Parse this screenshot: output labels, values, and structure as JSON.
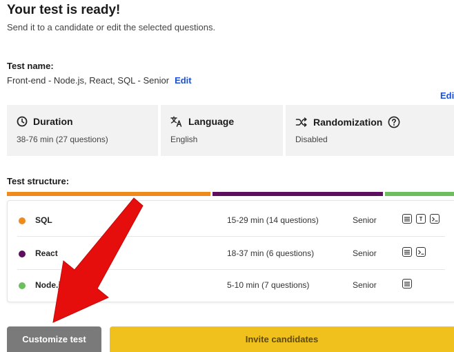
{
  "header": {
    "title": "Your test is ready!",
    "subtitle": "Send it to a candidate or edit the selected questions."
  },
  "test_name": {
    "label": "Test name:",
    "value": "Front-end - Node.js, React, SQL - Senior",
    "edit_label": "Edit",
    "edit_right_label": "Edi"
  },
  "info": {
    "duration": {
      "label": "Duration",
      "value": "38-76 min (27 questions)",
      "icon": "clock-icon"
    },
    "language": {
      "label": "Language",
      "value": "English",
      "icon": "translate-icon"
    },
    "randomization": {
      "label": "Randomization",
      "value": "Disabled",
      "icon": "shuffle-icon",
      "help_icon": "help-icon"
    }
  },
  "structure": {
    "label": "Test structure:",
    "segments": [
      {
        "name": "SQL",
        "fraction": 0.451,
        "color": "#ef8a1c"
      },
      {
        "name": "React",
        "fraction": 0.378,
        "color": "#5c0f5c"
      },
      {
        "name": "Node.js",
        "fraction": 0.171,
        "color": "#6cbf5c"
      }
    ],
    "rows": [
      {
        "name": "SQL",
        "duration": "15-29 min (14 questions)",
        "level": "Senior",
        "color": "#ef8a1c",
        "icons": [
          "document-icon",
          "text-icon",
          "terminal-icon"
        ]
      },
      {
        "name": "React",
        "duration": "18-37 min (6 questions)",
        "level": "Senior",
        "color": "#5c0f5c",
        "icons": [
          "document-icon",
          "terminal-icon"
        ]
      },
      {
        "name": "Node.js",
        "duration": "5-10 min (7 questions)",
        "level": "Senior",
        "color": "#6cbf5c",
        "icons": [
          "document-icon"
        ]
      }
    ]
  },
  "actions": {
    "customize_label": "Customize test",
    "invite_label": "Invite candidates"
  },
  "colors": {
    "link": "#1a4fd6",
    "invite_button": "#f0c01c",
    "customize_button": "#7a7a7a",
    "arrow": "#e60d0d"
  }
}
